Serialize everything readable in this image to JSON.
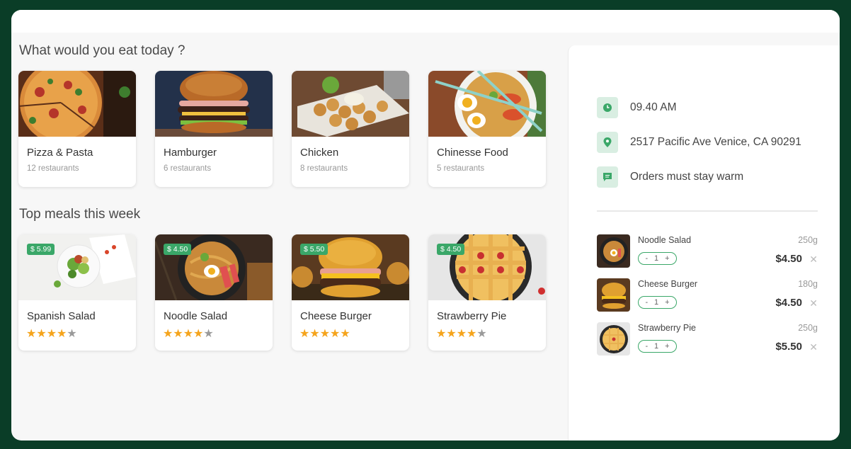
{
  "categories_title": "What would you eat today ?",
  "categories": [
    {
      "name": "Pizza & Pasta",
      "count": "12 restaurants"
    },
    {
      "name": "Hamburger",
      "count": "6 restaurants"
    },
    {
      "name": "Chicken",
      "count": "8 restaurants"
    },
    {
      "name": "Chinesse Food",
      "count": "5 restaurants"
    }
  ],
  "meals_title": "Top meals this week",
  "meals": [
    {
      "name": "Spanish Salad",
      "price": "$ 5.99",
      "rating": 4
    },
    {
      "name": "Noodle Salad",
      "price": "$ 4.50",
      "rating": 4
    },
    {
      "name": "Cheese Burger",
      "price": "$ 5.50",
      "rating": 5
    },
    {
      "name": "Strawberry Pie",
      "price": "$ 4.50",
      "rating": 4
    }
  ],
  "info": {
    "time": "09.40 AM",
    "address": "2517 Pacific Ave Venice, CA 90291",
    "note": "Orders must stay warm"
  },
  "orders": [
    {
      "name": "Noodle Salad",
      "weight": "250g",
      "qty": "1",
      "price": "$4.50",
      "minus": "-",
      "plus": "+",
      "remove": "✕"
    },
    {
      "name": "Cheese Burger",
      "weight": "180g",
      "qty": "1",
      "price": "$4.50",
      "minus": "-",
      "plus": "+",
      "remove": "✕"
    },
    {
      "name": "Strawberry Pie",
      "weight": "250g",
      "qty": "1",
      "price": "$5.50",
      "minus": "-",
      "plus": "+",
      "remove": "✕"
    }
  ],
  "icons": {
    "time": "clock-icon",
    "address": "location-pin-icon",
    "note": "message-icon"
  },
  "colors": {
    "accent": "#3aa768",
    "star": "#f5a41c",
    "frame": "#0a3d27"
  }
}
